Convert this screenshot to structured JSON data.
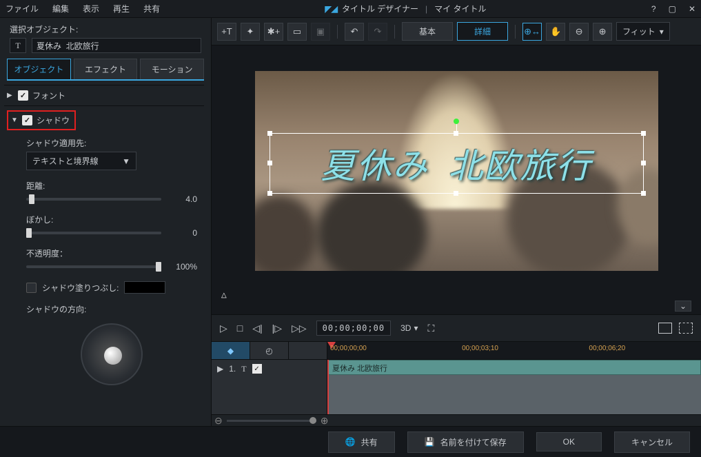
{
  "app": {
    "title": "タイトル デザイナー",
    "subtitle": "マイ タイトル"
  },
  "menu": {
    "file": "ファイル",
    "edit": "編集",
    "view": "表示",
    "play": "再生",
    "share": "共有"
  },
  "sidebar": {
    "select_label": "選択オブジェクト:",
    "object_name": "夏休み  北欧旅行",
    "tabs": {
      "object": "オブジェクト",
      "effect": "エフェクト",
      "motion": "モーション"
    },
    "font_group": "フォント",
    "shadow_group": "シャドウ",
    "shadow": {
      "apply_label": "シャドウ適用先:",
      "apply_value": "テキストと境界線",
      "distance_label": "距離:",
      "distance_value": "4.0",
      "blur_label": "ぼかし:",
      "blur_value": "0",
      "opacity_label": "不透明度：",
      "opacity_value": "100%",
      "fill_label": "シャドウ塗りつぶし:",
      "direction_label": "シャドウの方向:"
    }
  },
  "toolbar": {
    "mode_basic": "基本",
    "mode_advanced": "詳細",
    "fit": "フィット"
  },
  "title_text": "夏休み  北欧旅行",
  "playback": {
    "timecode": "00;00;00;00",
    "threed": "3D"
  },
  "timeline": {
    "t0": "00;00;00;00",
    "t1": "00;00;03;10",
    "t2": "00;00;06;20",
    "track_num": "1.",
    "clip_label": "夏休み  北欧旅行"
  },
  "bottom": {
    "share": "共有",
    "save_as": "名前を付けて保存",
    "ok": "OK",
    "cancel": "キャンセル"
  }
}
